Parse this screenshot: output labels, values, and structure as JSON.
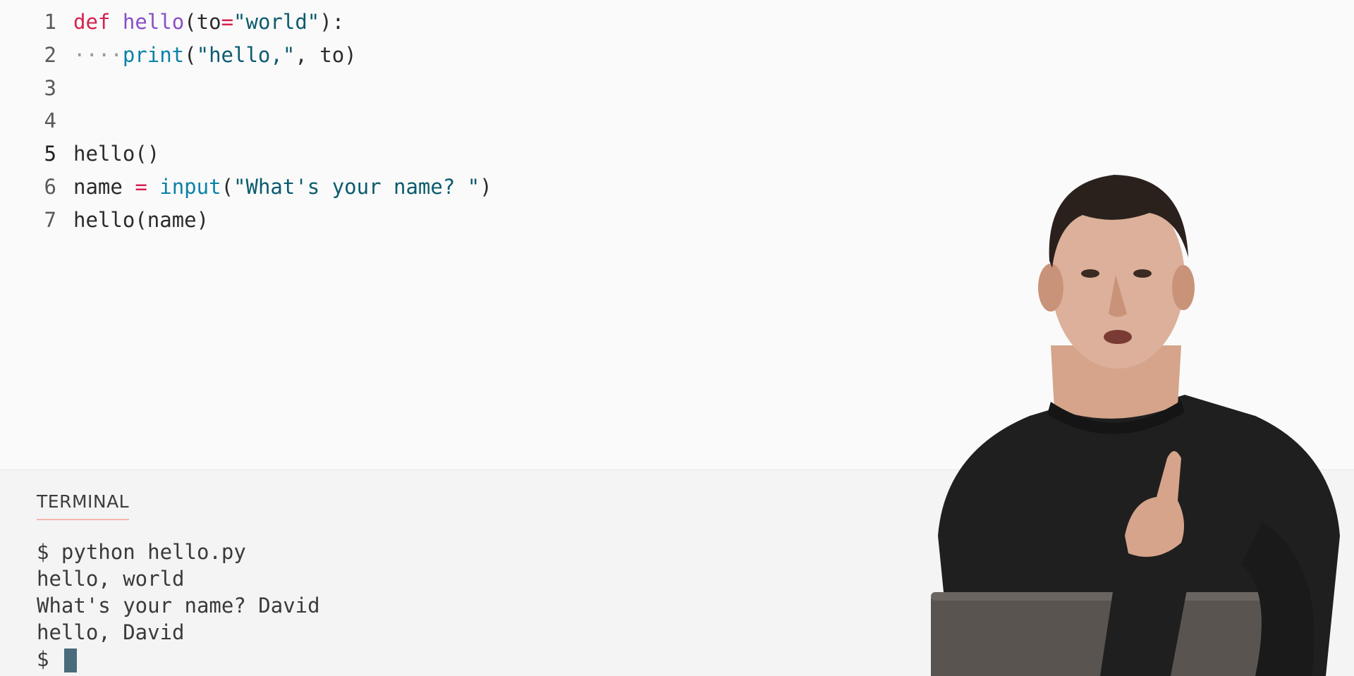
{
  "editor": {
    "lines": [
      {
        "num": "1",
        "tokens": [
          {
            "t": "def",
            "k": "kw"
          },
          {
            "t": " ",
            "k": "plain"
          },
          {
            "t": "hello",
            "k": "fn"
          },
          {
            "t": "(to",
            "k": "plain"
          },
          {
            "t": "=",
            "k": "op"
          },
          {
            "t": "\"world\"",
            "k": "str"
          },
          {
            "t": "):",
            "k": "plain"
          }
        ]
      },
      {
        "num": "2",
        "tokens": [
          {
            "t": "····",
            "k": "ws"
          },
          {
            "t": "print",
            "k": "builtin"
          },
          {
            "t": "(",
            "k": "plain"
          },
          {
            "t": "\"hello,\"",
            "k": "str"
          },
          {
            "t": ", to)",
            "k": "plain"
          }
        ]
      },
      {
        "num": "3",
        "tokens": []
      },
      {
        "num": "4",
        "tokens": []
      },
      {
        "num": "5",
        "tokens": [
          {
            "t": "hello()",
            "k": "plain"
          }
        ]
      },
      {
        "num": "6",
        "tokens": [
          {
            "t": "name ",
            "k": "plain"
          },
          {
            "t": "=",
            "k": "op"
          },
          {
            "t": " ",
            "k": "plain"
          },
          {
            "t": "input",
            "k": "builtin"
          },
          {
            "t": "(",
            "k": "plain"
          },
          {
            "t": "\"What's your name? \"",
            "k": "str"
          },
          {
            "t": ")",
            "k": "plain"
          }
        ]
      },
      {
        "num": "7",
        "tokens": [
          {
            "t": "hello(name)",
            "k": "plain"
          }
        ]
      }
    ],
    "active_line": "5"
  },
  "terminal": {
    "tab_label": "TERMINAL",
    "lines": [
      "$ python hello.py",
      "hello, world",
      "What's your name? David",
      "hello, David",
      "$ "
    ],
    "maximize_icon": "^",
    "close_icon": "✕"
  },
  "colors": {
    "keyword": "#d6204e",
    "function": "#8a4fc7",
    "builtin": "#0b82a8",
    "string": "#0c5b6e",
    "tab_underline": "#f2b8ad",
    "cursor": "#4a6b7a"
  }
}
